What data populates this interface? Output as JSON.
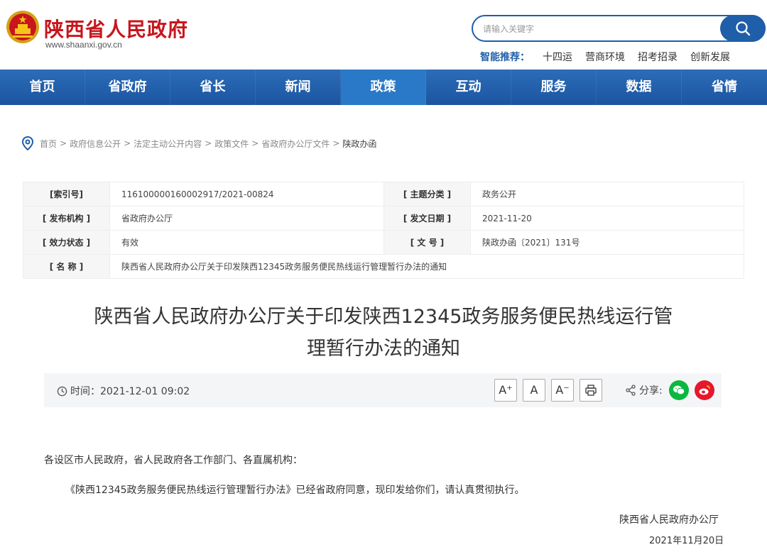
{
  "header": {
    "site_name": "陕西省人民政府",
    "site_url": "www.shaanxi.gov.cn",
    "search_placeholder": "请输入关键字",
    "smart_label": "智能推荐：",
    "smart_links": [
      "十四运",
      "营商环境",
      "招考招录",
      "创新发展"
    ]
  },
  "nav": {
    "items": [
      "首页",
      "省政府",
      "省长",
      "新闻",
      "政策",
      "互动",
      "服务",
      "数据",
      "省情"
    ],
    "active": "政策"
  },
  "breadcrumb": [
    "首页",
    "政府信息公开",
    "法定主动公开内容",
    "政策文件",
    "省政府办公厅文件",
    "陕政办函"
  ],
  "info": {
    "index_label": "[索引号]",
    "index_value": "116100000160002917/2021-00824",
    "topic_label": "[ 主题分类 ]",
    "topic_value": "政务公开",
    "publisher_label": "[ 发布机构 ]",
    "publisher_value": "省政府办公厅",
    "date_label": "[ 发文日期 ]",
    "date_value": "2021-11-20",
    "status_label": "[ 效力状态 ]",
    "status_value": "有效",
    "docno_label": "[ 文 号 ]",
    "docno_value": "陕政办函〔2021〕131号",
    "name_label": "[ 名 称 ]",
    "name_value": "陕西省人民政府办公厅关于印发陕西12345政务服务便民热线运行管理暂行办法的通知"
  },
  "title": {
    "line1": "陕西省人民政府办公厅关于印发陕西12345政务服务便民热线运行管",
    "line2": "理暂行办法的通知"
  },
  "meta": {
    "time": "时间：2021-12-01 09:02",
    "font_large": "A⁺",
    "font_normal": "A",
    "font_small": "A⁻",
    "share_label": "分享:"
  },
  "body": {
    "salutation": "各设区市人民政府，省人民政府各工作部门、各直属机构：",
    "paragraph1": "《陕西12345政务服务便民热线运行管理暂行办法》已经省政府同意，现印发给你们，请认真贯彻执行。",
    "signature": "陕西省人民政府办公厅",
    "date": "2021年11月20日"
  },
  "colors": {
    "brand_red": "#c8161d",
    "nav_blue": "#1f5ea8",
    "wechat_green": "#09b83e",
    "weibo_red": "#e6162d"
  },
  "icons": [
    "emblem-icon",
    "search-icon",
    "location-pin-icon",
    "clock-icon",
    "print-icon",
    "share-icon",
    "wechat-icon",
    "weibo-icon"
  ]
}
